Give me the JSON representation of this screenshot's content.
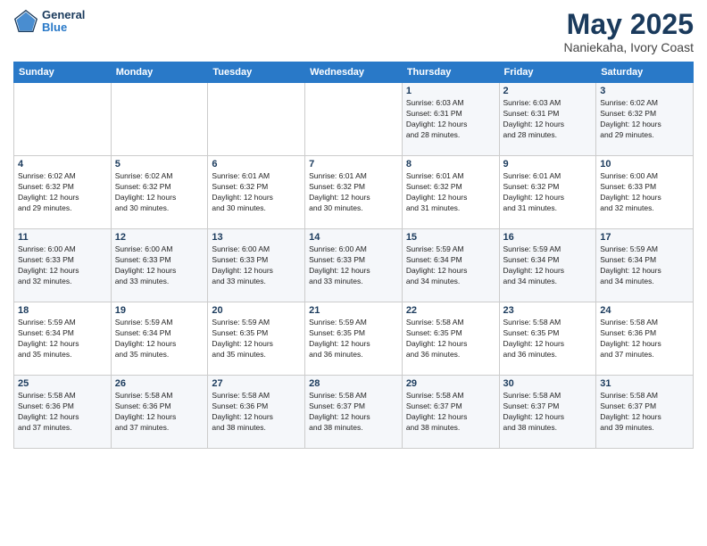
{
  "header": {
    "logo_general": "General",
    "logo_blue": "Blue",
    "month": "May 2025",
    "location": "Naniekaha, Ivory Coast"
  },
  "weekdays": [
    "Sunday",
    "Monday",
    "Tuesday",
    "Wednesday",
    "Thursday",
    "Friday",
    "Saturday"
  ],
  "weeks": [
    [
      {
        "day": "",
        "info": ""
      },
      {
        "day": "",
        "info": ""
      },
      {
        "day": "",
        "info": ""
      },
      {
        "day": "",
        "info": ""
      },
      {
        "day": "1",
        "info": "Sunrise: 6:03 AM\nSunset: 6:31 PM\nDaylight: 12 hours\nand 28 minutes."
      },
      {
        "day": "2",
        "info": "Sunrise: 6:03 AM\nSunset: 6:31 PM\nDaylight: 12 hours\nand 28 minutes."
      },
      {
        "day": "3",
        "info": "Sunrise: 6:02 AM\nSunset: 6:32 PM\nDaylight: 12 hours\nand 29 minutes."
      }
    ],
    [
      {
        "day": "4",
        "info": "Sunrise: 6:02 AM\nSunset: 6:32 PM\nDaylight: 12 hours\nand 29 minutes."
      },
      {
        "day": "5",
        "info": "Sunrise: 6:02 AM\nSunset: 6:32 PM\nDaylight: 12 hours\nand 30 minutes."
      },
      {
        "day": "6",
        "info": "Sunrise: 6:01 AM\nSunset: 6:32 PM\nDaylight: 12 hours\nand 30 minutes."
      },
      {
        "day": "7",
        "info": "Sunrise: 6:01 AM\nSunset: 6:32 PM\nDaylight: 12 hours\nand 30 minutes."
      },
      {
        "day": "8",
        "info": "Sunrise: 6:01 AM\nSunset: 6:32 PM\nDaylight: 12 hours\nand 31 minutes."
      },
      {
        "day": "9",
        "info": "Sunrise: 6:01 AM\nSunset: 6:32 PM\nDaylight: 12 hours\nand 31 minutes."
      },
      {
        "day": "10",
        "info": "Sunrise: 6:00 AM\nSunset: 6:33 PM\nDaylight: 12 hours\nand 32 minutes."
      }
    ],
    [
      {
        "day": "11",
        "info": "Sunrise: 6:00 AM\nSunset: 6:33 PM\nDaylight: 12 hours\nand 32 minutes."
      },
      {
        "day": "12",
        "info": "Sunrise: 6:00 AM\nSunset: 6:33 PM\nDaylight: 12 hours\nand 33 minutes."
      },
      {
        "day": "13",
        "info": "Sunrise: 6:00 AM\nSunset: 6:33 PM\nDaylight: 12 hours\nand 33 minutes."
      },
      {
        "day": "14",
        "info": "Sunrise: 6:00 AM\nSunset: 6:33 PM\nDaylight: 12 hours\nand 33 minutes."
      },
      {
        "day": "15",
        "info": "Sunrise: 5:59 AM\nSunset: 6:34 PM\nDaylight: 12 hours\nand 34 minutes."
      },
      {
        "day": "16",
        "info": "Sunrise: 5:59 AM\nSunset: 6:34 PM\nDaylight: 12 hours\nand 34 minutes."
      },
      {
        "day": "17",
        "info": "Sunrise: 5:59 AM\nSunset: 6:34 PM\nDaylight: 12 hours\nand 34 minutes."
      }
    ],
    [
      {
        "day": "18",
        "info": "Sunrise: 5:59 AM\nSunset: 6:34 PM\nDaylight: 12 hours\nand 35 minutes."
      },
      {
        "day": "19",
        "info": "Sunrise: 5:59 AM\nSunset: 6:34 PM\nDaylight: 12 hours\nand 35 minutes."
      },
      {
        "day": "20",
        "info": "Sunrise: 5:59 AM\nSunset: 6:35 PM\nDaylight: 12 hours\nand 35 minutes."
      },
      {
        "day": "21",
        "info": "Sunrise: 5:59 AM\nSunset: 6:35 PM\nDaylight: 12 hours\nand 36 minutes."
      },
      {
        "day": "22",
        "info": "Sunrise: 5:58 AM\nSunset: 6:35 PM\nDaylight: 12 hours\nand 36 minutes."
      },
      {
        "day": "23",
        "info": "Sunrise: 5:58 AM\nSunset: 6:35 PM\nDaylight: 12 hours\nand 36 minutes."
      },
      {
        "day": "24",
        "info": "Sunrise: 5:58 AM\nSunset: 6:36 PM\nDaylight: 12 hours\nand 37 minutes."
      }
    ],
    [
      {
        "day": "25",
        "info": "Sunrise: 5:58 AM\nSunset: 6:36 PM\nDaylight: 12 hours\nand 37 minutes."
      },
      {
        "day": "26",
        "info": "Sunrise: 5:58 AM\nSunset: 6:36 PM\nDaylight: 12 hours\nand 37 minutes."
      },
      {
        "day": "27",
        "info": "Sunrise: 5:58 AM\nSunset: 6:36 PM\nDaylight: 12 hours\nand 38 minutes."
      },
      {
        "day": "28",
        "info": "Sunrise: 5:58 AM\nSunset: 6:37 PM\nDaylight: 12 hours\nand 38 minutes."
      },
      {
        "day": "29",
        "info": "Sunrise: 5:58 AM\nSunset: 6:37 PM\nDaylight: 12 hours\nand 38 minutes."
      },
      {
        "day": "30",
        "info": "Sunrise: 5:58 AM\nSunset: 6:37 PM\nDaylight: 12 hours\nand 38 minutes."
      },
      {
        "day": "31",
        "info": "Sunrise: 5:58 AM\nSunset: 6:37 PM\nDaylight: 12 hours\nand 39 minutes."
      }
    ]
  ]
}
